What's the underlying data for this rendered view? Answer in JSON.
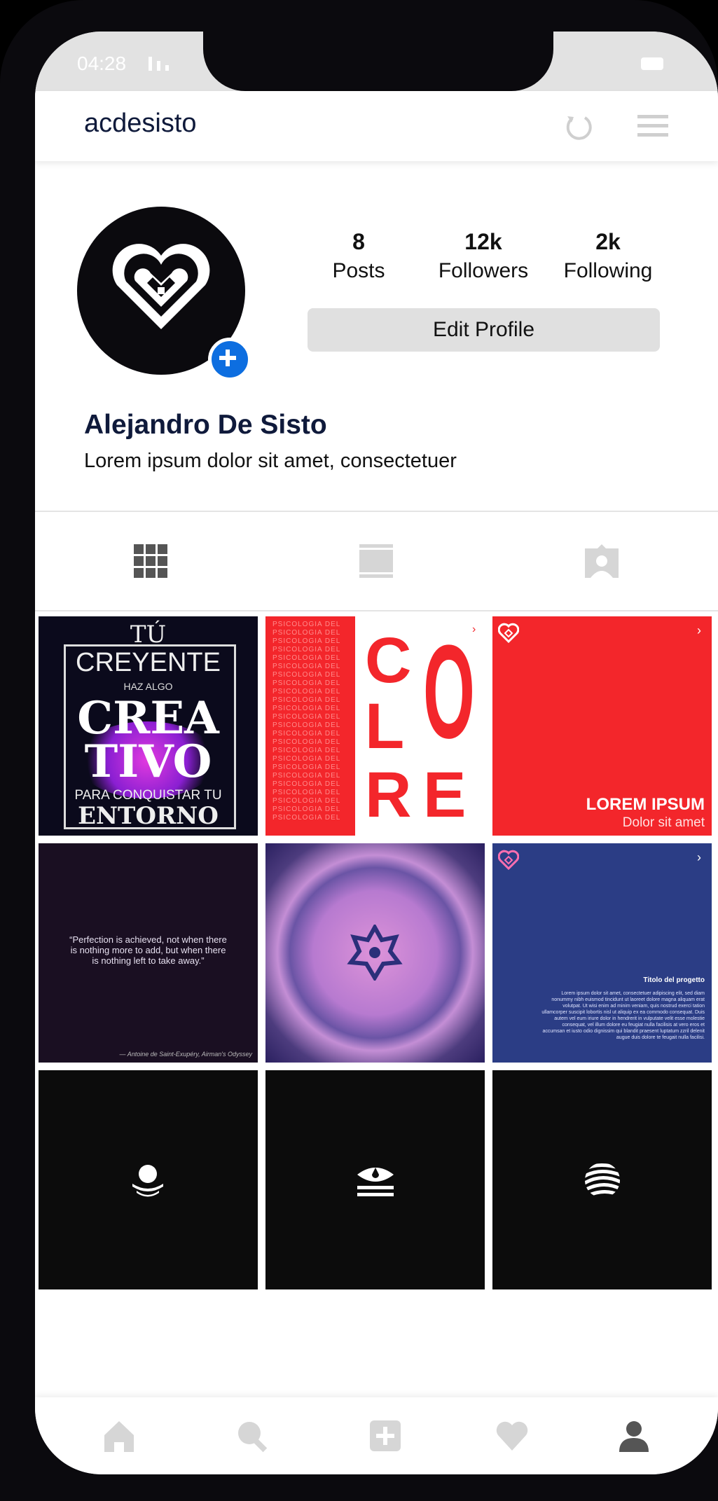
{
  "status": {
    "time": "04:28"
  },
  "header": {
    "username": "acdesisto"
  },
  "profile": {
    "stats": [
      {
        "value": "8",
        "label": "Posts"
      },
      {
        "value": "12k",
        "label": "Followers"
      },
      {
        "value": "2k",
        "label": "Following"
      }
    ],
    "edit_label": "Edit Profile",
    "name": "Alejandro De Sisto",
    "bio": "Lorem ipsum dolor sit amet, consectetuer"
  },
  "posts": {
    "creativo": {
      "line1": "TÚ",
      "line2": "CREYENTE",
      "line3": "HAZ ALGO",
      "line4": "CREA",
      "line5": "TIVO",
      "line6": "PARA CONQUISTAR TU",
      "line7": "ENTORNO"
    },
    "colore": {
      "repeat": "PSICOLOGIA DEL",
      "letters": [
        "C",
        "O",
        "L",
        "O",
        "R",
        "E"
      ]
    },
    "lorem": {
      "title": "LOREM IPSUM",
      "subtitle": "Dolor sit amet"
    },
    "quote": {
      "text": "“Perfection is achieved, not when there is nothing more to add, but when there is nothing left to take away.”",
      "author": "— Antoine de Saint-Exupéry, Airman's Odyssey"
    },
    "project": {
      "title": "Titolo del progetto",
      "body": "Lorem ipsum dolor sit amet, consectetuer adipiscing elit, sed diam nonummy nibh euismod tincidunt ut laoreet dolore magna aliquam erat volutpat. Ut wisi enim ad minim veniam, quis nostrud exerci tation ullamcorper suscipit lobortis nisl ut aliquip ex ea commodo consequat. Duis autem vel eum iriure dolor in hendrerit in vulputate velit esse molestie consequat, vel illum dolore eu feugiat nulla facilisis at vero eros et accumsan et iusto odio dignissim qui blandit praesent luptatum zzril delenit augue duis dolore te feugait nulla facilisi."
    }
  },
  "colors": {
    "brand_red": "#f3262b",
    "navy": "#2b3d85",
    "dark_purple": "#1a0f22",
    "accent_blue": "#0d6ee0"
  }
}
